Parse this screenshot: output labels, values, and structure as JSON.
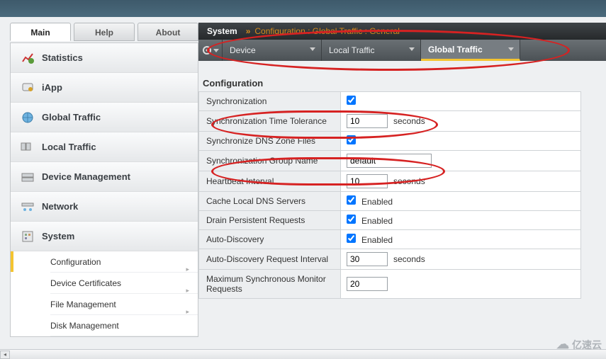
{
  "top_tabs": {
    "main": "Main",
    "help": "Help",
    "about": "About"
  },
  "sidebar": {
    "items": [
      {
        "label": "Statistics"
      },
      {
        "label": "iApp"
      },
      {
        "label": "Global Traffic"
      },
      {
        "label": "Local Traffic"
      },
      {
        "label": "Device Management"
      },
      {
        "label": "Network"
      },
      {
        "label": "System"
      }
    ],
    "system_sub": [
      {
        "label": "Configuration",
        "active": true
      },
      {
        "label": "Device Certificates"
      },
      {
        "label": "File Management"
      },
      {
        "label": "Disk Management"
      }
    ]
  },
  "breadcrumb": {
    "root": "System",
    "sep": "»",
    "trail": "Configuration : Global Traffic : General"
  },
  "menu": {
    "device": "Device",
    "local_traffic": "Local Traffic",
    "global_traffic": "Global Traffic"
  },
  "section_title": "Configuration",
  "form": {
    "sync": {
      "label": "Synchronization",
      "checked": true
    },
    "sync_tol": {
      "label": "Synchronization Time Tolerance",
      "value": "10",
      "unit": "seconds"
    },
    "sync_dns": {
      "label": "Synchronize DNS Zone Files",
      "checked": true
    },
    "sync_group": {
      "label": "Synchronization Group Name",
      "value": "default"
    },
    "heartbeat": {
      "label": "Heartbeat Interval",
      "value": "10",
      "unit": "seconds"
    },
    "cache_dns": {
      "label": "Cache Local DNS Servers",
      "checked": true,
      "cblabel": "Enabled"
    },
    "drain": {
      "label": "Drain Persistent Requests",
      "checked": true,
      "cblabel": "Enabled"
    },
    "auto_disc": {
      "label": "Auto-Discovery",
      "checked": true,
      "cblabel": "Enabled"
    },
    "auto_disc_int": {
      "label": "Auto-Discovery Request Interval",
      "value": "30",
      "unit": "seconds"
    },
    "max_sync": {
      "label": "Maximum Synchronous Monitor Requests",
      "value": "20"
    }
  },
  "watermark": "亿速云"
}
